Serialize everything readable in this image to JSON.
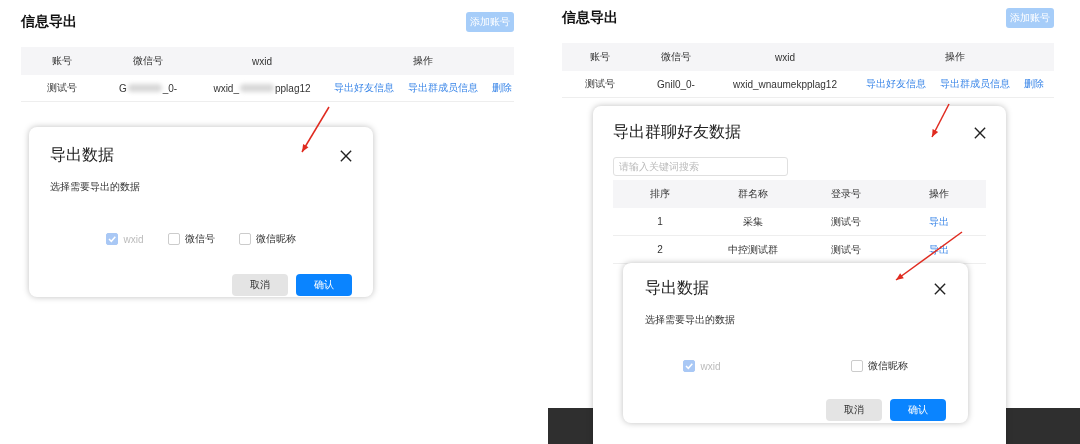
{
  "panels": [
    {
      "title": "信息导出",
      "add_button": "添加账号",
      "table": {
        "columns": [
          "账号",
          "微信号",
          "wxid",
          "操作"
        ],
        "rows": [
          {
            "cells": [
              {
                "kind": "text",
                "text": "测试号"
              },
              {
                "kind": "redacted",
                "prefix": "G",
                "suffix": "_0-"
              },
              {
                "kind": "redacted",
                "prefix": "wxid_",
                "suffix": "pplag12"
              }
            ],
            "actions": [
              "导出好友信息",
              "导出群成员信息",
              "删除"
            ]
          }
        ]
      },
      "dialogs": [
        {
          "kind": "export-options",
          "title": "导出数据",
          "prompt": "选择需要导出的数据",
          "options": [
            {
              "label": "wxid",
              "checked": true,
              "disabled": true
            },
            {
              "label": "微信号",
              "checked": false,
              "disabled": false
            },
            {
              "label": "微信昵称",
              "checked": false,
              "disabled": false
            }
          ],
          "buttons": [
            {
              "label": "取消",
              "kind": "secondary"
            },
            {
              "label": "确认",
              "kind": "primary"
            }
          ]
        }
      ]
    },
    {
      "title": "信息导出",
      "add_button": "添加账号",
      "table": {
        "columns": [
          "账号",
          "微信号",
          "wxid",
          "操作"
        ],
        "rows": [
          {
            "cells": [
              {
                "kind": "text",
                "text": "测试号"
              },
              {
                "kind": "text",
                "text": "Gnil0_0-"
              },
              {
                "kind": "text",
                "text": "wxid_wnaumekpplag12"
              }
            ],
            "actions": [
              "导出好友信息",
              "导出群成员信息",
              "删除"
            ]
          }
        ]
      },
      "dialogs": [
        {
          "kind": "group-list",
          "title": "导出群聊好友数据",
          "search": {
            "placeholder": "请输入关键词搜索"
          },
          "columns": [
            "排序",
            "群名称",
            "登录号",
            "操作"
          ],
          "rows": [
            {
              "cells": [
                "1",
                "采集",
                "测试号"
              ],
              "action": "导出"
            },
            {
              "cells": [
                "2",
                "中控测试群",
                "测试号"
              ],
              "action": "导出"
            }
          ]
        },
        {
          "kind": "export-options",
          "title": "导出数据",
          "prompt": "选择需要导出的数据",
          "options": [
            {
              "label": "wxid",
              "checked": true,
              "disabled": true
            },
            {
              "label": "微信昵称",
              "checked": false,
              "disabled": false
            }
          ],
          "buttons": [
            {
              "label": "取消",
              "kind": "secondary"
            },
            {
              "label": "确认",
              "kind": "primary"
            }
          ]
        }
      ]
    }
  ]
}
